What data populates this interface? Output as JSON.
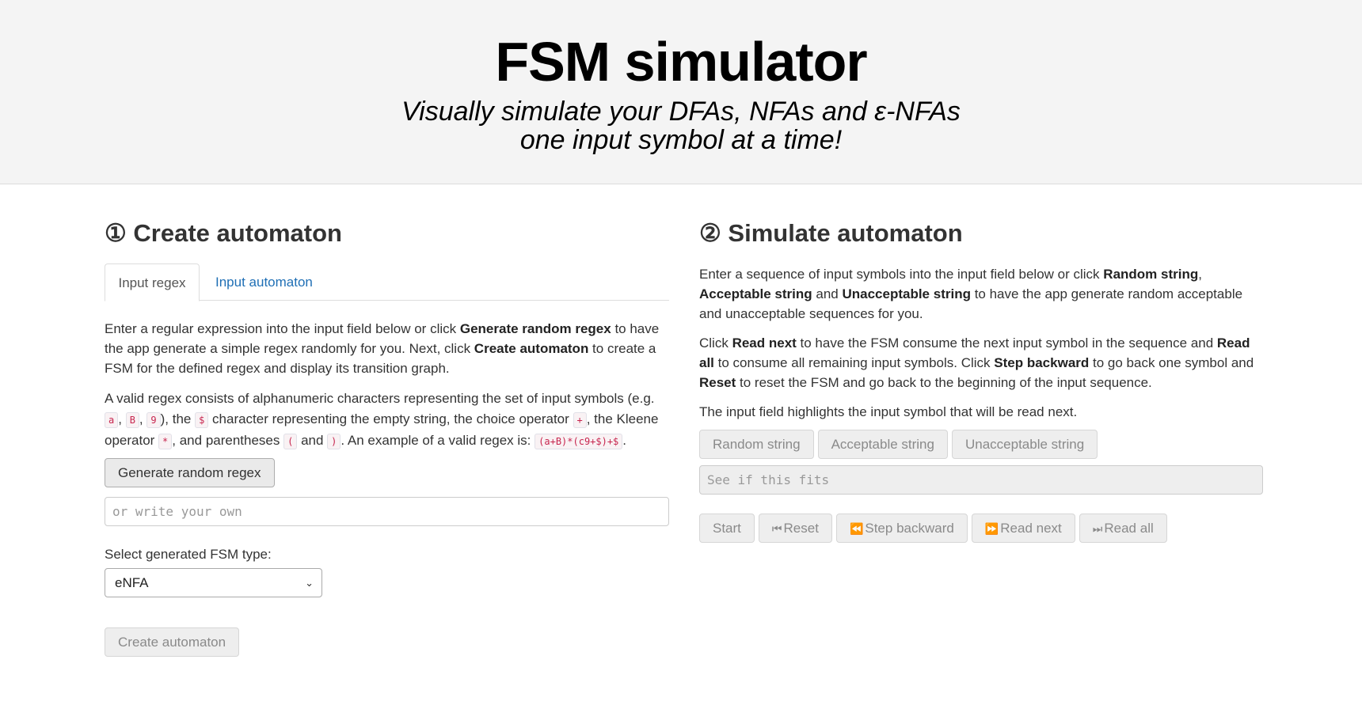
{
  "header": {
    "title": "FSM simulator",
    "subtitle_line1": "Visually simulate your DFAs, NFAs and ε-NFAs",
    "subtitle_line2": "one input symbol at a time!"
  },
  "create": {
    "heading": "① Create automaton",
    "tabs": [
      {
        "label": "Input regex",
        "active": true
      },
      {
        "label": "Input automaton",
        "active": false
      }
    ],
    "p1": {
      "t1": "Enter a regular expression into the input field below or click ",
      "b1": "Generate random regex",
      "t2": " to have the app generate a simple regex randomly for you. Next, click ",
      "b2": "Create automaton",
      "t3": " to create a FSM for the defined regex and display its transition graph."
    },
    "p2": {
      "t1": "A valid regex consists of alphanumeric characters representing the set of input symbols (e.g. ",
      "c1": "a",
      "s1": ", ",
      "c2": "B",
      "s2": ", ",
      "c3": "9",
      "t2": "), the ",
      "c4": "$",
      "t3": " character representing the empty string, the choice operator ",
      "c5": "+",
      "t4": ", the Kleene operator ",
      "c6": "*",
      "t5": ", and parentheses ",
      "c7": "(",
      "t6": " and ",
      "c8": ")",
      "t7": ". An example of a valid regex is: ",
      "c9": "(a+B)*(c9+$)+$",
      "t8": "."
    },
    "generate_button": "Generate random regex",
    "regex_input_placeholder": "or write your own",
    "fsm_type_label": "Select generated FSM type:",
    "fsm_type_selected": "eNFA",
    "create_button": "Create automaton"
  },
  "simulate": {
    "heading": "② Simulate automaton",
    "p1": {
      "t1": "Enter a sequence of input symbols into the input field below or click ",
      "b1": "Random string",
      "t2": ", ",
      "b2": "Acceptable string",
      "t3": " and ",
      "b3": "Unacceptable string",
      "t4": " to have the app generate random acceptable and unacceptable sequences for you."
    },
    "p2": {
      "t1": "Click ",
      "b1": "Read next",
      "t2": " to have the FSM consume the next input symbol in the sequence and ",
      "b2": "Read all",
      "t3": " to consume all remaining input symbols. Click ",
      "b3": "Step backward",
      "t4": " to go back one symbol and ",
      "b4": "Reset",
      "t5": " to reset the FSM and go back to the beginning of the input sequence."
    },
    "p3": "The input field highlights the input symbol that will be read next.",
    "string_buttons": [
      "Random string",
      "Acceptable string",
      "Unacceptable string"
    ],
    "sequence_input_placeholder": "See if this fits",
    "control_buttons": {
      "start": "Start",
      "reset": "Reset",
      "step_backward": "Step backward",
      "read_next": "Read next",
      "read_all": "Read all"
    }
  }
}
